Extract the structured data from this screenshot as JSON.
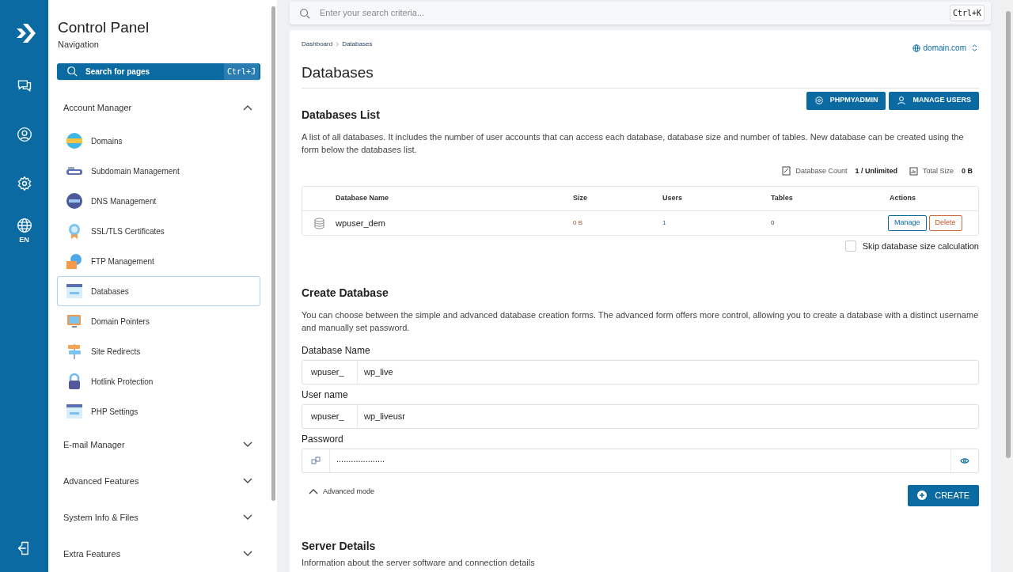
{
  "rail": {
    "language": "EN"
  },
  "sidebar": {
    "title": "Control Panel",
    "subtitle": "Navigation",
    "search": {
      "placeholder": "Search for pages",
      "shortcut": "Ctrl+J"
    },
    "sections": [
      {
        "label": "Account Manager",
        "expanded": true,
        "items": [
          {
            "label": "Domains",
            "selected": false
          },
          {
            "label": "Subdomain Management",
            "selected": false
          },
          {
            "label": "DNS Management",
            "selected": false
          },
          {
            "label": "SSL/TLS Certificates",
            "selected": false
          },
          {
            "label": "FTP Management",
            "selected": false
          },
          {
            "label": "Databases",
            "selected": true
          },
          {
            "label": "Domain Pointers",
            "selected": false
          },
          {
            "label": "Site Redirects",
            "selected": false
          },
          {
            "label": "Hotlink Protection",
            "selected": false
          },
          {
            "label": "PHP Settings",
            "selected": false
          }
        ]
      },
      {
        "label": "E-mail Manager",
        "expanded": false
      },
      {
        "label": "Advanced Features",
        "expanded": false
      },
      {
        "label": "System Info & Files",
        "expanded": false
      },
      {
        "label": "Extra Features",
        "expanded": false
      }
    ]
  },
  "top_search": {
    "placeholder": "Enter your search criteria...",
    "shortcut": "Ctrl+K"
  },
  "breadcrumb": [
    "Dashboard",
    "Databases"
  ],
  "domain_selector": "domain.com",
  "title": "Databases",
  "buttons": [
    {
      "label": "PHPMYADMIN",
      "kind": "gear"
    },
    {
      "label": "MANAGE USERS",
      "kind": "user"
    }
  ],
  "databases_list": {
    "title": "Databases List",
    "description": "A list of all databases. It includes the number of user accounts that can access each database, database size and number of tables. New database can be created using the form below the databases list.",
    "stats": [
      {
        "label": "Database Count",
        "value": "1 / Unlimited",
        "kind": "count"
      },
      {
        "label": "Total Size",
        "value": "0 B",
        "kind": "size"
      }
    ],
    "table": {
      "columns": [
        "Database Name",
        "Size",
        "Users",
        "Tables",
        "Actions"
      ],
      "rows": [
        {
          "name": "wpuser_dem",
          "size": "0 B",
          "users": "1",
          "tables": "0",
          "actions": [
            "Manage",
            "Delete"
          ]
        }
      ]
    },
    "skip_size": {
      "label": "Skip database size calculation",
      "checked": false
    }
  },
  "create_database": {
    "title": "Create Database",
    "description": "You can choose between the simple and advanced database creation forms. The advanced form offers more control, allowing you to create a database with a distinct username and manually set password.",
    "fields": [
      {
        "label": "Database Name",
        "kind": "prefixed",
        "prefix": "wpuser_",
        "value": "wp_live"
      },
      {
        "label": "User name",
        "kind": "prefixed",
        "prefix": "wpuser_",
        "value": "wp_liveusr"
      },
      {
        "label": "Password",
        "kind": "password",
        "value": "...................."
      }
    ],
    "advanced_mode": {
      "label": "Advanced mode",
      "expanded": true
    },
    "create_button": "CREATE"
  },
  "server_details": {
    "title": "Server Details",
    "description": "Information about the server software and connection details"
  }
}
